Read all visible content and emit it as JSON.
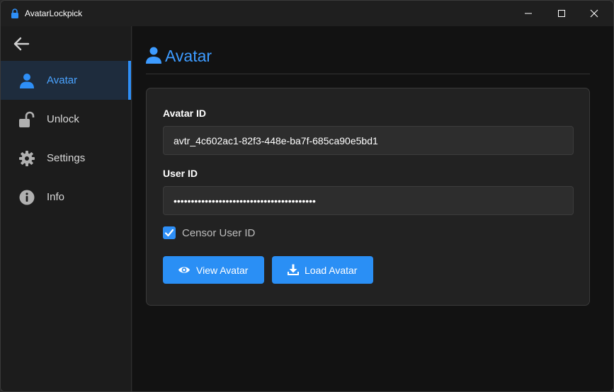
{
  "window": {
    "title": "AvatarLockpick",
    "controls": [
      "minimize",
      "maximize",
      "close"
    ]
  },
  "sidebar": {
    "back_icon": "arrow-left-icon",
    "items": [
      {
        "label": "Avatar",
        "icon": "user-icon",
        "active": true
      },
      {
        "label": "Unlock",
        "icon": "unlock-icon",
        "active": false
      },
      {
        "label": "Settings",
        "icon": "gear-icon",
        "active": false
      },
      {
        "label": "Info",
        "icon": "info-icon",
        "active": false
      }
    ]
  },
  "main": {
    "title": "Avatar",
    "title_icon": "user-icon",
    "avatar_id": {
      "label": "Avatar ID",
      "value": "avtr_4c602ac1-82f3-448e-ba7f-685ca90e5bd1"
    },
    "user_id": {
      "label": "User ID",
      "value": "•••••••••••••••••••••••••••••••••••••••••"
    },
    "censor": {
      "label": "Censor User ID",
      "checked": true
    },
    "buttons": {
      "view_label": "View Avatar",
      "view_icon": "eye-icon",
      "load_label": "Load Avatar",
      "load_icon": "download-icon"
    }
  },
  "colors": {
    "accent": "#2e8ff7",
    "title_text": "#3d9bff",
    "sidebar_active_bg": "#1e2c3d",
    "card_bg": "#222222",
    "field_bg": "#2d2d2d",
    "main_bg": "#121212"
  }
}
